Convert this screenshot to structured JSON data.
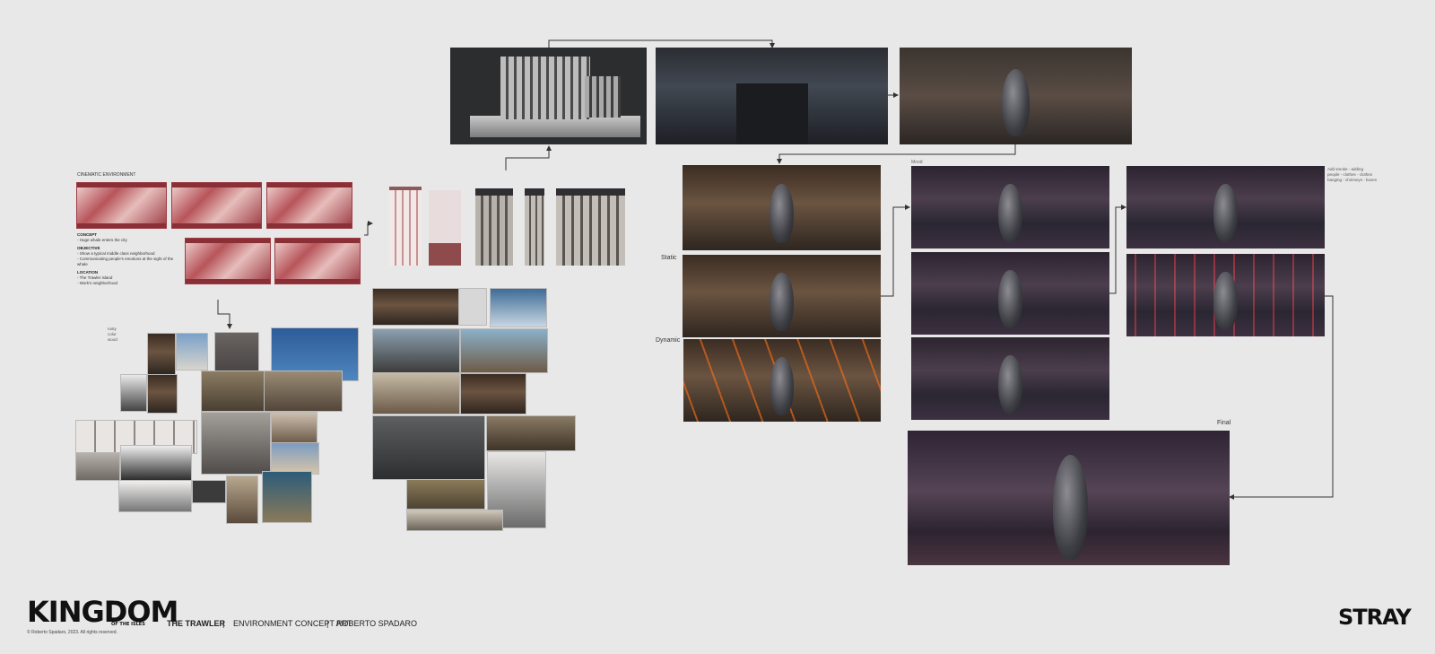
{
  "project": {
    "brand": "KINGDOM",
    "brand_sub": "OF THE ISLES",
    "copyright": "© Roberto Spadaro, 2023. All rights reserved.",
    "title": "THE TRAWLER",
    "separator": "|",
    "category": "ENVIRONMENT  CONCEPT ART",
    "author": "ROBERTO SPADARO",
    "studio_logo": "STRAY"
  },
  "notes": {
    "header": "CINEMATIC ENVIRONMENT",
    "concept_h": "CONCEPT",
    "concept_1": "- Huge whale enters the city",
    "objective_h": "OBJECTIVE",
    "objective_1": "- Show a typical middle class neighborhood",
    "objective_2": "- Communicating people's emotions at the sight of the whale",
    "location_h": "LOCATION",
    "location_1": "- The Trawler island",
    "location_2": "- Work's neighborhood"
  },
  "annotations": {
    "collage_note": "rusty\ncolor\nwood",
    "mood_label": "Mood",
    "static_label": "Static",
    "dynamic_label": "Dynamic",
    "final_label": "Final",
    "side_note": "Add smoke - adding\npeople - clothes - clothes\nhanging - chimneys - boxes"
  },
  "colors": {
    "background": "#e8e8e8",
    "storyboard_red": "#9c3b43",
    "overpaint_orange": "#ff6e14",
    "redline_red": "#d21414",
    "arrow": "#333333"
  }
}
